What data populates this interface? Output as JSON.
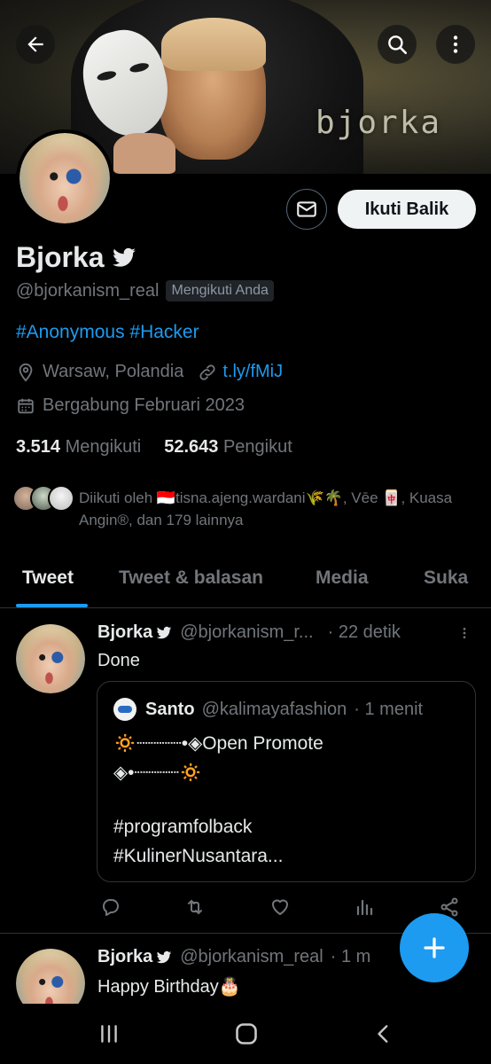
{
  "banner": {
    "brand_text": "bjorka"
  },
  "header": {
    "back_icon": "arrow-left-icon",
    "search_icon": "search-icon",
    "more_icon": "more-vertical-icon"
  },
  "profile": {
    "display_name": "Bjorka",
    "handle": "@bjorkanism_real",
    "follows_you_badge": "Mengikuti Anda",
    "bio": "#Anonymous #Hacker",
    "location": "Warsaw, Polandia",
    "link": "t.ly/fMiJ",
    "joined": "Bergabung Februari 2023",
    "following_count": "3.514",
    "following_label": "Mengikuti",
    "followers_count": "52.643",
    "followers_label": "Pengikut",
    "follow_back_label": "Ikuti Balik",
    "mutual_text": "Diikuti oleh 🇮🇩tisna.ajeng.wardani🌾🌴, Vēe 🀄, Kuasa Angin®, dan 179 lainnya"
  },
  "tabs": [
    {
      "label": "Tweet",
      "active": true
    },
    {
      "label": "Tweet & balasan",
      "active": false
    },
    {
      "label": "Media",
      "active": false
    },
    {
      "label": "Suka",
      "active": false
    }
  ],
  "tweets": [
    {
      "name": "Bjorka",
      "handle": "@bjorkanism_r...",
      "time": "· 22 detik",
      "text": "Done",
      "quote": {
        "name": "Santo",
        "handle": "@kalimayafashion",
        "time": "· 1 menit",
        "line1": "🔅┈┈┈┈•◈Open Promote",
        "line2": "◈•┈┈┈┈🔅",
        "line3": "#programfolback",
        "line4": "#KulinerNusantara..."
      }
    },
    {
      "name": "Bjorka",
      "handle": "@bjorkanism_real",
      "time": "· 1 m",
      "text": "Happy Birthday🎂"
    }
  ],
  "colors": {
    "accent": "#1d9bf0",
    "background": "#000000",
    "muted": "#71767b"
  }
}
